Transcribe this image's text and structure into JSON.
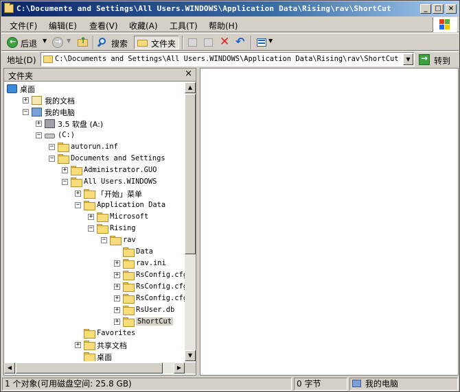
{
  "window": {
    "title": "C:\\Documents and Settings\\All Users.WINDOWS\\Application Data\\Rising\\rav\\ShortCut"
  },
  "menu": [
    "文件(F)",
    "编辑(E)",
    "查看(V)",
    "收藏(A)",
    "工具(T)",
    "帮助(H)"
  ],
  "toolbar": {
    "back_label": "后退",
    "search_label": "搜索",
    "folders_label": "文件夹"
  },
  "address": {
    "label": "地址(D)",
    "value": "C:\\Documents and Settings\\All Users.WINDOWS\\Application Data\\Rising\\rav\\ShortCut",
    "go_label": "转到"
  },
  "folder_pane": {
    "title": "文件夹",
    "close": "×"
  },
  "tree": [
    {
      "label": "桌面",
      "indent": 0,
      "expander": "",
      "icon": "desktop-icon"
    },
    {
      "label": "我的文档",
      "indent": 1,
      "expander": "+",
      "icon": "my-documents-icon"
    },
    {
      "label": "我的电脑",
      "indent": 1,
      "expander": "-",
      "icon": "my-computer-icon"
    },
    {
      "label": "3.5 软盘 (A:)",
      "indent": 2,
      "expander": "+",
      "icon": "floppy-drive-icon"
    },
    {
      "label": "(C:)",
      "indent": 2,
      "expander": "-",
      "icon": "hard-drive-icon"
    },
    {
      "label": "autorun.inf",
      "indent": 3,
      "expander": "-",
      "icon": "folder-icon"
    },
    {
      "label": "Documents and Settings",
      "indent": 3,
      "expander": "-",
      "icon": "folder-icon"
    },
    {
      "label": "Administrator.GUO",
      "indent": 4,
      "expander": "+",
      "icon": "folder-icon"
    },
    {
      "label": "All Users.WINDOWS",
      "indent": 4,
      "expander": "-",
      "icon": "folder-icon"
    },
    {
      "label": "「开始」菜单",
      "indent": 5,
      "expander": "+",
      "icon": "folder-icon"
    },
    {
      "label": "Application Data",
      "indent": 5,
      "expander": "-",
      "icon": "folder-icon"
    },
    {
      "label": "Microsoft",
      "indent": 6,
      "expander": "+",
      "icon": "folder-icon"
    },
    {
      "label": "Rising",
      "indent": 6,
      "expander": "-",
      "icon": "folder-icon"
    },
    {
      "label": "rav",
      "indent": 7,
      "expander": "-",
      "icon": "folder-icon"
    },
    {
      "label": "Data",
      "indent": 8,
      "expander": "",
      "icon": "folder-icon"
    },
    {
      "label": "rav.ini",
      "indent": 8,
      "expander": "+",
      "icon": "folder-icon"
    },
    {
      "label": "RsConfig.cfg",
      "indent": 8,
      "expander": "+",
      "icon": "folder-icon"
    },
    {
      "label": "RsConfig.cfg.b",
      "indent": 8,
      "expander": "+",
      "icon": "folder-icon"
    },
    {
      "label": "RsConfig.cfg.t",
      "indent": 8,
      "expander": "+",
      "icon": "folder-icon"
    },
    {
      "label": "RsUser.db",
      "indent": 8,
      "expander": "+",
      "icon": "folder-icon"
    },
    {
      "label": "ShortCut",
      "indent": 8,
      "expander": "+",
      "icon": "folder-icon",
      "selected": true
    },
    {
      "label": "Favorites",
      "indent": 5,
      "expander": "",
      "icon": "folder-icon"
    },
    {
      "label": "共享文档",
      "indent": 5,
      "expander": "+",
      "icon": "folder-icon"
    },
    {
      "label": "桌面",
      "indent": 5,
      "expander": "",
      "icon": "folder-icon"
    }
  ],
  "status": {
    "objects": "1 个对象(可用磁盘空间: 25.8 GB)",
    "size": "0 字节",
    "location": "我的电脑"
  }
}
